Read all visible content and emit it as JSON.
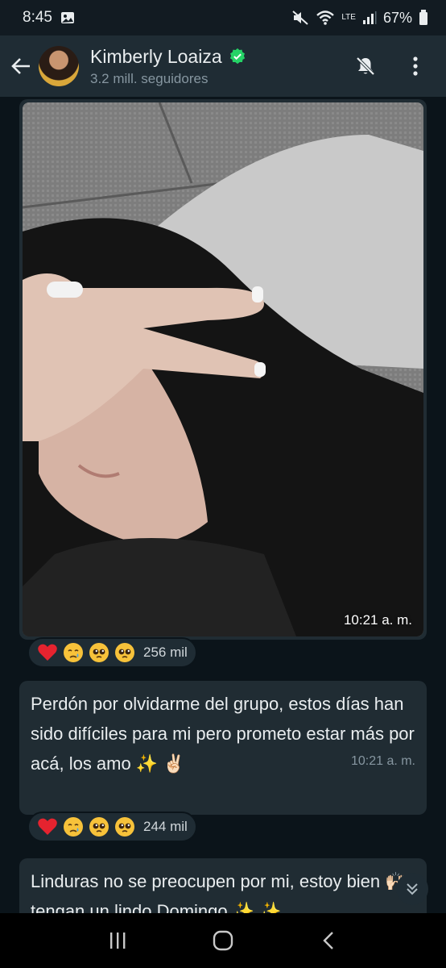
{
  "status_bar": {
    "time": "8:45",
    "battery": "67%",
    "network": "LTE"
  },
  "header": {
    "channel_name": "Kimberly Loaiza",
    "followers": "3.2 mill. seguidores"
  },
  "messages": [
    {
      "type": "image",
      "time": "10:21 a. m.",
      "reactions": {
        "emojis": [
          "red-heart",
          "sad-relieved-face",
          "pleading-face",
          "pleading-face"
        ],
        "count": "256 mil"
      }
    },
    {
      "type": "text",
      "text": "Perdón por olvidarme del grupo, estos días han sido difíciles para mi pero prometo estar más por acá, los amo ✨ ✌🏻",
      "time": "10:21 a. m.",
      "reactions": {
        "emojis": [
          "red-heart",
          "sad-relieved-face",
          "pleading-face",
          "pleading-face"
        ],
        "count": "244 mil"
      }
    },
    {
      "type": "text",
      "text": "Linduras no se preocupen por mi, estoy bien 🙌🏻 tengan un lindo Domingo ✨ ✨"
    }
  ],
  "colors": {
    "background": "#0b141a",
    "header": "#1f2c34",
    "bubble": "#202c33",
    "verified": "#25d366",
    "secondary_text": "#8696a0"
  },
  "icons": [
    "back-arrow-icon",
    "verified-icon",
    "muted-bell-icon",
    "more-vert-icon",
    "chevron-down-icon",
    "recent-apps-icon",
    "home-icon",
    "back-icon"
  ]
}
